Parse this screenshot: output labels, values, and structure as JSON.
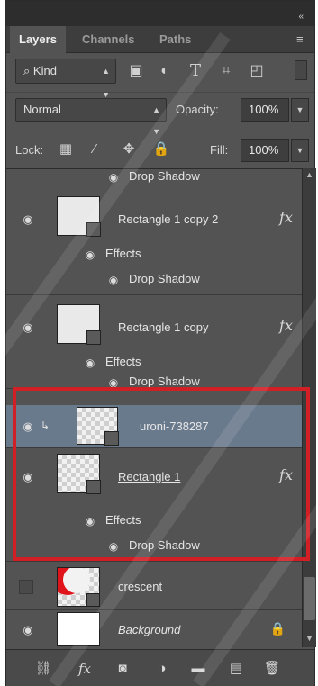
{
  "panel": {
    "title_buttons": {
      "collapse": "«",
      "close": "×"
    },
    "tabs": [
      {
        "label": "Layers",
        "active": true
      },
      {
        "label": "Channels",
        "active": false
      },
      {
        "label": "Paths",
        "active": false
      }
    ],
    "panel_menu_icon": "panel-menu-icon"
  },
  "filter": {
    "kind_label": "Kind",
    "icons": [
      "image-filter-icon",
      "adjustment-filter-icon",
      "type-filter-icon",
      "shape-filter-icon",
      "smart-object-filter-icon"
    ]
  },
  "blend": {
    "mode": "Normal",
    "opacity_label": "Opacity:",
    "opacity_value": "100%"
  },
  "lock": {
    "label": "Lock:",
    "icons": [
      "lock-transparent-icon",
      "lock-image-icon",
      "lock-position-icon",
      "lock-all-icon"
    ],
    "fill_label": "Fill:",
    "fill_value": "100%"
  },
  "layers": {
    "top_partial_effect": "Drop Shadow",
    "items": [
      {
        "name": "Rectangle 1 copy 2",
        "effects_label": "Effects",
        "effect": "Drop Shadow",
        "fx": "fx"
      },
      {
        "name": "Rectangle 1 copy",
        "effects_label": "Effects",
        "effect": "Drop Shadow",
        "fx": "fx"
      },
      {
        "name": "uroni-738287",
        "clipped": true
      },
      {
        "name": "Rectangle 1",
        "effects_label": "Effects",
        "effect": "Drop Shadow",
        "fx": "fx"
      },
      {
        "name": "crescent"
      },
      {
        "name": "Background",
        "locked": true
      }
    ]
  },
  "bottom_bar": {
    "icons": [
      "link-layers-icon",
      "add-style-icon",
      "add-mask-icon",
      "new-adjustment-icon",
      "new-group-icon",
      "new-layer-icon",
      "delete-layer-icon"
    ],
    "fx_label": "fx"
  },
  "colors": {
    "panel_bg": "#535353",
    "selected_row": "#6a7a8d",
    "highlight_box": "#d21f26"
  }
}
